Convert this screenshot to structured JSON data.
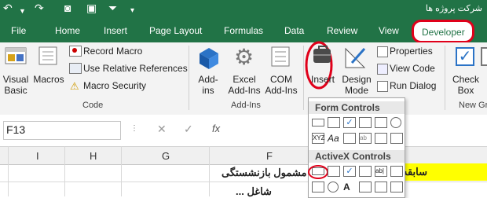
{
  "title_bar": {
    "document_title": "شرکت پروژه ها"
  },
  "tabs": [
    "File",
    "Home",
    "Insert",
    "Page Layout",
    "Formulas",
    "Data",
    "Review",
    "View",
    "Developer"
  ],
  "ribbon": {
    "code_group": {
      "visual_basic": [
        "Visual",
        "Basic"
      ],
      "macros": "Macros",
      "record_macro": "Record Macro",
      "use_relative_references": "Use Relative References",
      "macro_security": "Macro Security",
      "group_name": "Code"
    },
    "addins_group": {
      "add_ins": [
        "Add-",
        "ins"
      ],
      "excel_add_ins": [
        "Excel",
        "Add-Ins"
      ],
      "com_add_ins": [
        "COM",
        "Add-Ins"
      ],
      "group_name": "Add-Ins"
    },
    "controls_group": {
      "insert": "Insert",
      "design_mode": [
        "Design",
        "Mode"
      ],
      "properties": "Properties",
      "view_code": "View Code",
      "run_dialog": "Run Dialog"
    },
    "check_box": [
      "Check",
      "Box"
    ],
    "new_group_partial": "New Gr"
  },
  "formula_bar": {
    "name_box": "F13",
    "fx": "fx"
  },
  "columns": [
    "I",
    "H",
    "G",
    "F"
  ],
  "cells": {
    "row1_right": "سابقه",
    "row1_f": "مشمول بازنشستگی",
    "row2_f": "شاغل ..."
  },
  "dropdown": {
    "form_controls": "Form Controls",
    "activex_controls": "ActiveX Controls"
  },
  "colors": {
    "excel_green": "#217346",
    "highlight_red": "#e0001a",
    "yellow_cell": "#ffff00"
  }
}
